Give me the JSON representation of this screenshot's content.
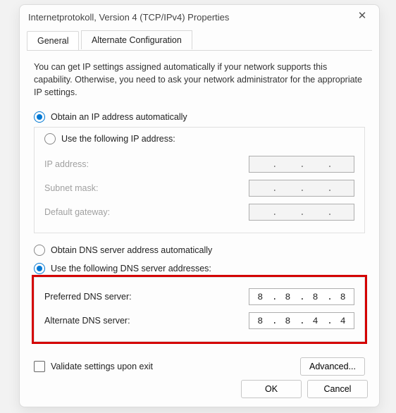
{
  "title": "Internetprotokoll, Version 4 (TCP/IPv4) Properties",
  "tabs": {
    "general": "General",
    "alternate": "Alternate Configuration"
  },
  "intro": "You can get IP settings assigned automatically if your network supports this capability. Otherwise, you need to ask your network administrator for the appropriate IP settings.",
  "ip_section": {
    "radio_auto": "Obtain an IP address automatically",
    "radio_manual": "Use the following IP address:",
    "ip_address_label": "IP address:",
    "subnet_label": "Subnet mask:",
    "gateway_label": "Default gateway:",
    "dots": [
      "",
      ".",
      "",
      ".",
      "",
      ".",
      ""
    ]
  },
  "dns_section": {
    "radio_auto": "Obtain DNS server address automatically",
    "radio_manual": "Use the following DNS server addresses:",
    "preferred_label": "Preferred DNS server:",
    "alternate_label": "Alternate DNS server:",
    "preferred": {
      "o1": "8",
      "o2": "8",
      "o3": "8",
      "o4": "8"
    },
    "alternate": {
      "o1": "8",
      "o2": "8",
      "o3": "4",
      "o4": "4"
    }
  },
  "validate_label": "Validate settings upon exit",
  "advanced_label": "Advanced...",
  "ok_label": "OK",
  "cancel_label": "Cancel"
}
